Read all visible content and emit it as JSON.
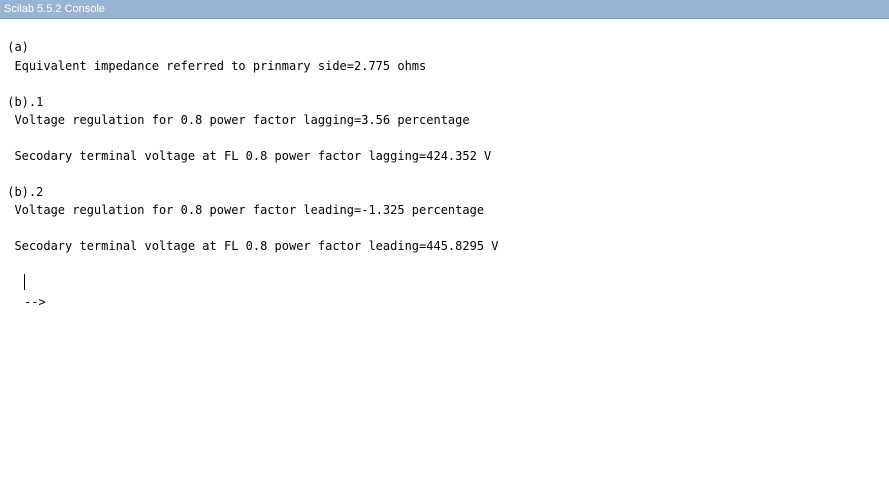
{
  "window": {
    "title": "Scilab 5.5.2 Console"
  },
  "console": {
    "lines": [
      " (a)",
      "  Equivalent impedance referred to prinmary side=2.775 ohms",
      " (b).1",
      "  Voltage regulation for 0.8 power factor lagging=3.56 percentage",
      "  Secodary terminal voltage at FL 0.8 power factor lagging=424.352 V",
      " (b).2",
      "  Voltage regulation for 0.8 power factor leading=-1.325 percentage",
      "  Secodary terminal voltage at FL 0.8 power factor leading=445.8295 V"
    ],
    "prompt": "-->"
  }
}
